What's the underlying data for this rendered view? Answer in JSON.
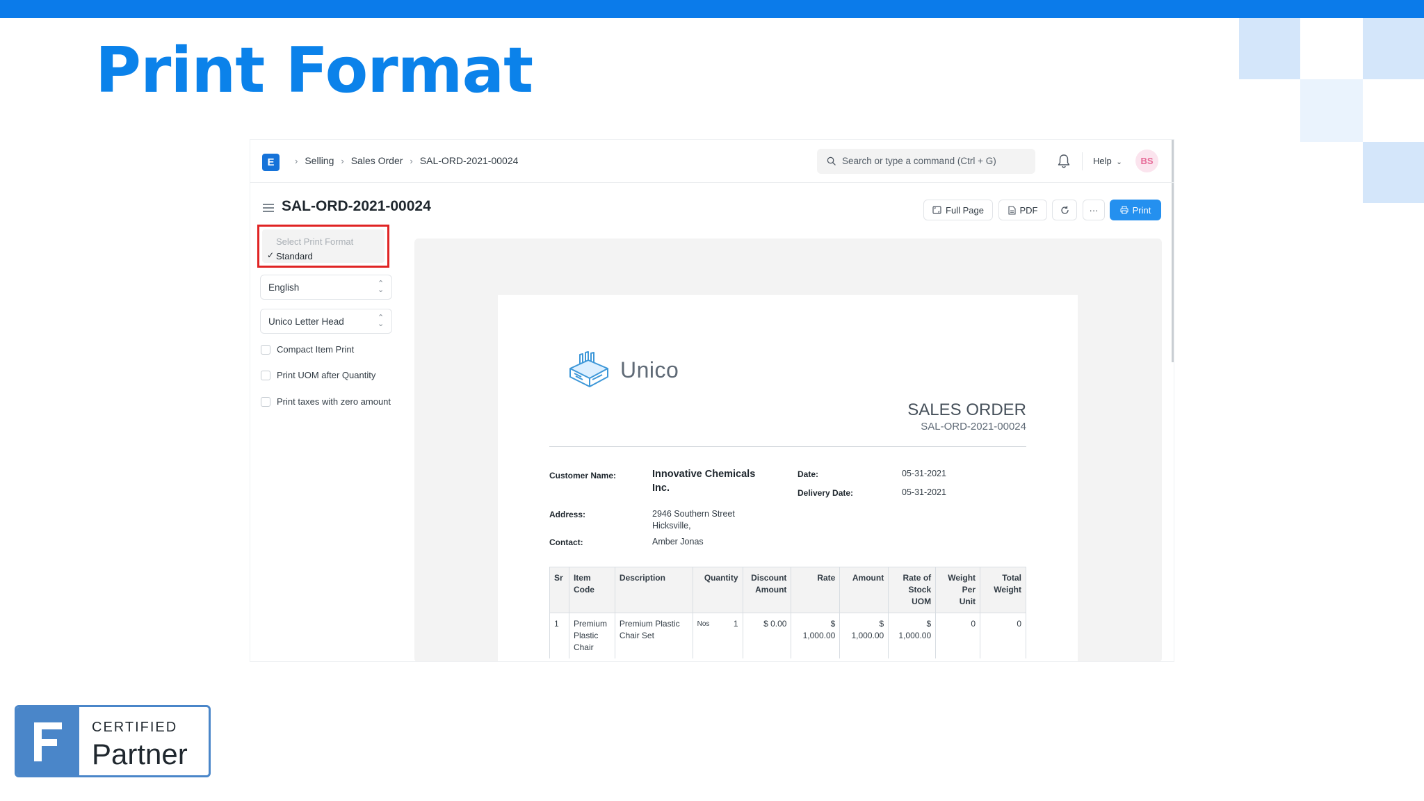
{
  "slide": {
    "title": "Print Format"
  },
  "navbar": {
    "logo_letter": "E",
    "breadcrumbs": [
      "Selling",
      "Sales Order",
      "SAL-ORD-2021-00024"
    ],
    "search_placeholder": "Search or type a command (Ctrl + G)",
    "help_label": "Help",
    "avatar_initials": "BS"
  },
  "page": {
    "title": "SAL-ORD-2021-00024",
    "buttons": {
      "full_page": "Full Page",
      "pdf": "PDF",
      "more": "···",
      "print": "Print"
    }
  },
  "sidebar": {
    "format_dropdown": {
      "placeholder": "Select Print Format",
      "selected": "Standard"
    },
    "language": "English",
    "letter_head": "Unico Letter Head",
    "checkboxes": [
      "Compact Item Print",
      "Print UOM after Quantity",
      "Print taxes with zero amount"
    ]
  },
  "document": {
    "company": "Unico",
    "heading": "SALES ORDER",
    "number": "SAL-ORD-2021-00024",
    "customer_label": "Customer Name:",
    "customer_line1": "Innovative Chemicals",
    "customer_line2": "Inc.",
    "date_label": "Date:",
    "date_value": "05-31-2021",
    "delivery_label": "Delivery Date:",
    "delivery_value": "05-31-2021",
    "address_label": "Address:",
    "address_line1": "2946 Southern Street",
    "address_line2": "Hicksville,",
    "contact_label": "Contact:",
    "contact_value": "Amber Jonas",
    "table": {
      "headers": {
        "sr": "Sr",
        "item_code_1": "Item",
        "item_code_2": "Code",
        "description": "Description",
        "quantity": "Quantity",
        "discount_1": "Discount",
        "discount_2": "Amount",
        "rate": "Rate",
        "amount": "Amount",
        "rate_stock_1": "Rate of",
        "rate_stock_2": "Stock",
        "rate_stock_3": "UOM",
        "weight_1": "Weight",
        "weight_2": "Per",
        "weight_3": "Unit",
        "total_weight_1": "Total",
        "total_weight_2": "Weight"
      },
      "row": {
        "sr": "1",
        "item_code_1": "Premium",
        "item_code_2": "Plastic",
        "item_code_3": "Chair",
        "description_1": "Premium Plastic",
        "description_2": "Chair Set",
        "uom": "Nos",
        "qty": "1",
        "discount": "$ 0.00",
        "rate_1": "$",
        "rate_2": "1,000.00",
        "amount_1": "$",
        "amount_2": "1,000.00",
        "rate_stock_1": "$",
        "rate_stock_2": "1,000.00",
        "weight": "0",
        "total_weight": "0"
      }
    }
  },
  "badge": {
    "line1": "CERTIFIED",
    "line2": "Partner"
  },
  "colors": {
    "brand_blue": "#0b7bea",
    "primary_button": "#2490ef",
    "highlight_red": "#e02424",
    "badge_blue": "#4a86c9"
  }
}
